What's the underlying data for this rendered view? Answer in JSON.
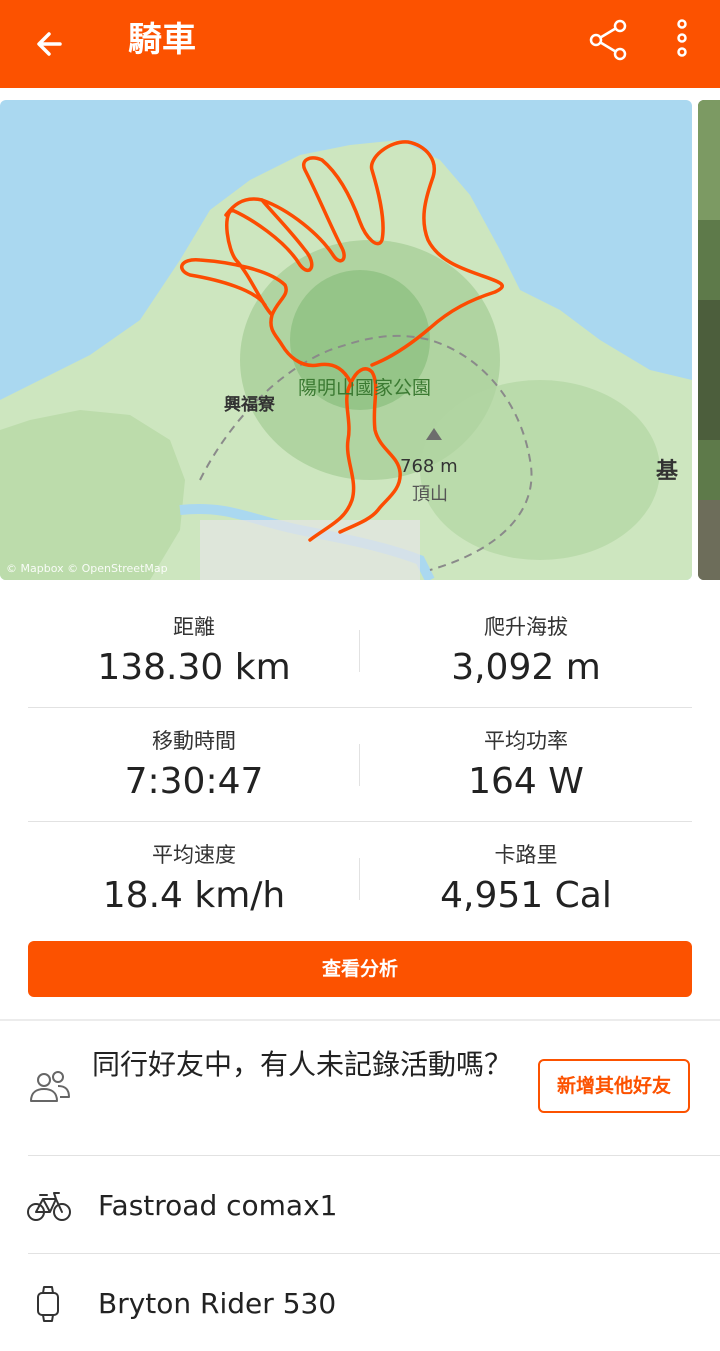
{
  "header": {
    "title": "騎車",
    "back_icon": "arrow-left-icon",
    "share_icon": "share-icon",
    "more_icon": "more-vertical-icon"
  },
  "map": {
    "park_label": "陽明山國家公園",
    "town_label": "興福寮",
    "peak_elevation": "768 m",
    "peak_name": "頂山",
    "edge_label": "基",
    "attribution": "© Mapbox © OpenStreetMap",
    "route_color": "#fc4c02"
  },
  "stats": {
    "rows": [
      {
        "left": {
          "label": "距離",
          "value": "138.30 km"
        },
        "right": {
          "label": "爬升海拔",
          "value": "3,092 m"
        }
      },
      {
        "left": {
          "label": "移動時間",
          "value": "7:30:47"
        },
        "right": {
          "label": "平均功率",
          "value": "164 W"
        }
      },
      {
        "left": {
          "label": "平均速度",
          "value": "18.4 km/h"
        },
        "right": {
          "label": "卡路里",
          "value": "4,951 Cal"
        }
      }
    ]
  },
  "analyze_button": "查看分析",
  "friends": {
    "prompt": "同行好友中，有人未記錄活動嗎？",
    "add_button": "新增其他好友",
    "icon": "people-icon"
  },
  "gear": {
    "bike": "Fastroad comax1",
    "bike_icon": "bicycle-icon",
    "device": "Bryton Rider 530",
    "device_icon": "watch-icon"
  },
  "colors": {
    "brand": "#fc5200",
    "sea": "#aad8f0",
    "land": "#cde6bf"
  }
}
